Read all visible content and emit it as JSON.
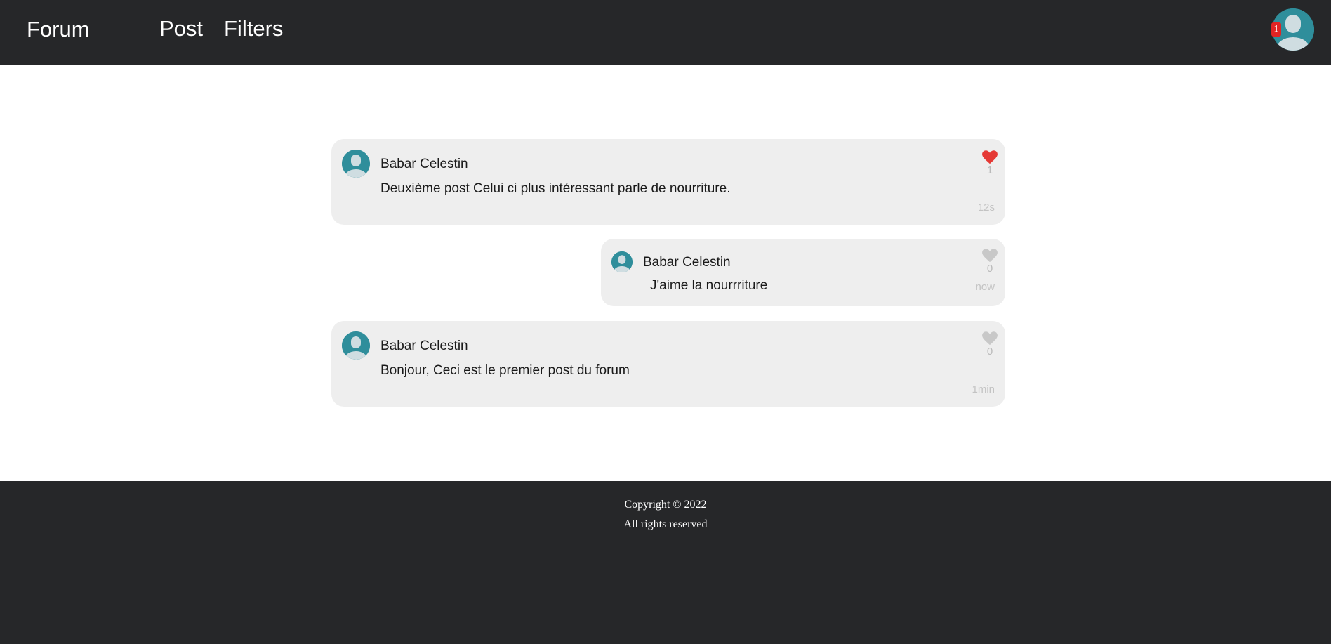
{
  "nav": {
    "brand": "Forum",
    "links": [
      "Post",
      "Filters"
    ]
  },
  "user": {
    "notification_count": "1",
    "icon": "user-avatar-icon"
  },
  "posts": [
    {
      "author": "Babar Celestin",
      "body": "Deuxième post Celui ci plus intéressant parle de nourriture.",
      "likes": "1",
      "liked": true,
      "time": "12s"
    },
    {
      "author": "Babar Celestin",
      "body": "J'aime la nourrriture",
      "likes": "0",
      "liked": false,
      "time": "now"
    },
    {
      "author": "Babar Celestin",
      "body": "Bonjour, Ceci est le premier post du forum",
      "likes": "0",
      "liked": false,
      "time": "1min"
    }
  ],
  "footer": {
    "copyright": "Copyright © 2022",
    "rights": "All rights reserved"
  },
  "colors": {
    "nav_bg": "#262729",
    "card_bg": "#eeeeee",
    "avatar_teal": "#2f8e9b",
    "like_active": "#e53935",
    "like_inactive": "#c8c8c8",
    "badge_red": "#e02424"
  }
}
